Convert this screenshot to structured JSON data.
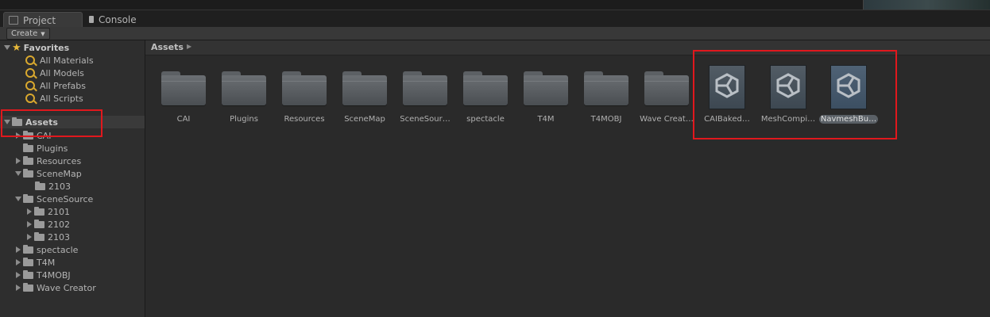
{
  "tabs": [
    {
      "label": "Project",
      "icon": "folder-icon"
    },
    {
      "label": "Console",
      "icon": "console-icon"
    }
  ],
  "toolbar": {
    "create_label": "Create"
  },
  "favorites": {
    "label": "Favorites",
    "items": [
      "All Materials",
      "All Models",
      "All Prefabs",
      "All Scripts"
    ]
  },
  "tree": {
    "root": "Assets",
    "items": [
      {
        "label": "CAI",
        "depth": 1,
        "arrow": "closed"
      },
      {
        "label": "Plugins",
        "depth": 1,
        "arrow": "none"
      },
      {
        "label": "Resources",
        "depth": 1,
        "arrow": "closed"
      },
      {
        "label": "SceneMap",
        "depth": 1,
        "arrow": "open"
      },
      {
        "label": "2103",
        "depth": 2,
        "arrow": "none"
      },
      {
        "label": "SceneSource",
        "depth": 1,
        "arrow": "open"
      },
      {
        "label": "2101",
        "depth": 2,
        "arrow": "closed"
      },
      {
        "label": "2102",
        "depth": 2,
        "arrow": "closed"
      },
      {
        "label": "2103",
        "depth": 2,
        "arrow": "closed"
      },
      {
        "label": "spectacle",
        "depth": 1,
        "arrow": "closed"
      },
      {
        "label": "T4M",
        "depth": 1,
        "arrow": "closed"
      },
      {
        "label": "T4MOBJ",
        "depth": 1,
        "arrow": "closed"
      },
      {
        "label": "Wave Creator",
        "depth": 1,
        "arrow": "closed"
      }
    ]
  },
  "breadcrumb": {
    "label": "Assets"
  },
  "grid": {
    "folders": [
      "CAI",
      "Plugins",
      "Resources",
      "SceneMap",
      "SceneSour…",
      "spectacle",
      "T4M",
      "T4MOBJ",
      "Wave Creat…"
    ],
    "assets": [
      {
        "label": "CAIBaked…",
        "selected": false
      },
      {
        "label": "MeshCompi…",
        "selected": false
      },
      {
        "label": "NavmeshBu…",
        "selected": true
      }
    ]
  },
  "colors": {
    "annotation": "#e0181d",
    "background": "#2a2a2a",
    "folder": "#5c6064"
  }
}
